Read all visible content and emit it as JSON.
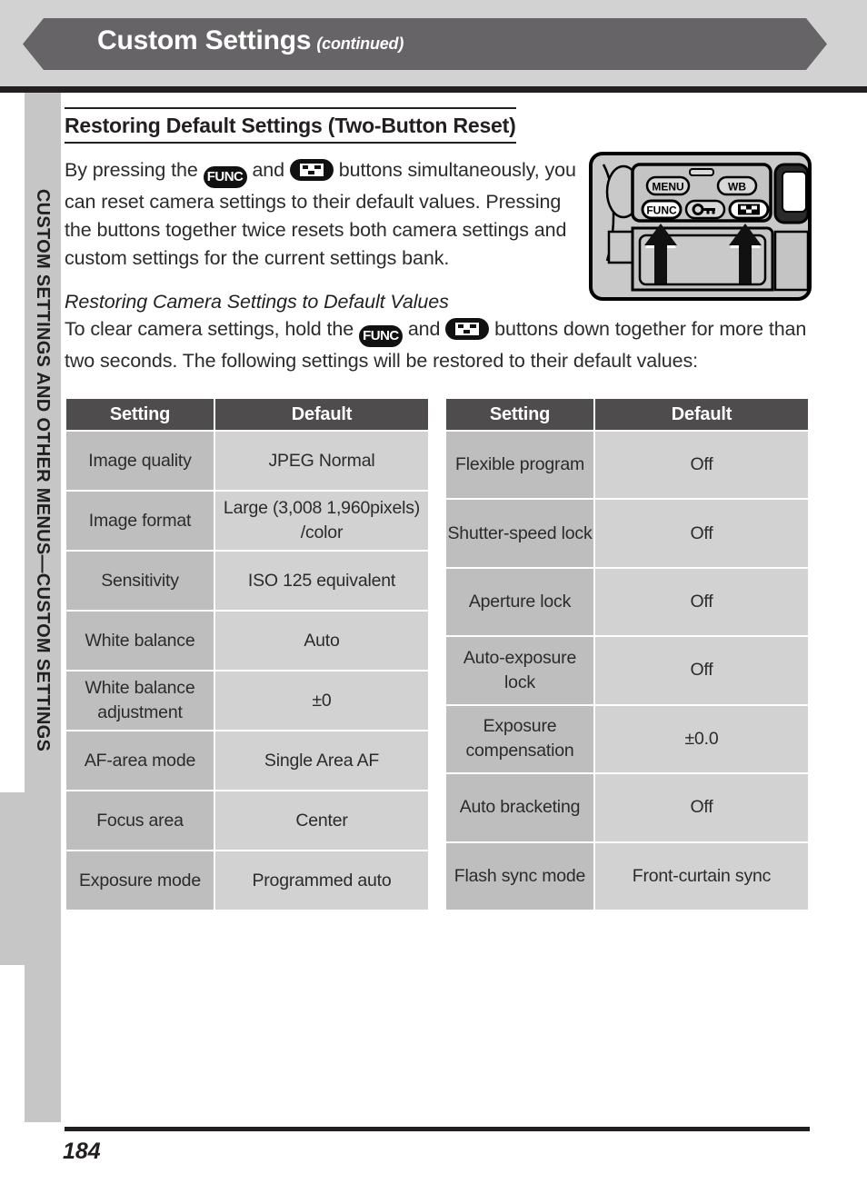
{
  "header": {
    "title": "Custom Settings",
    "continued": "(continued)",
    "band_color": "#666466"
  },
  "side_tab": {
    "label": "CUSTOM SETTINGS AND OTHER MENUS—CUSTOM SETTINGS"
  },
  "section": {
    "title": "Restoring Default Settings (Two-Button Reset)",
    "paragraph_1_a": "By pressing the",
    "paragraph_1_b": "and",
    "paragraph_1_c": "buttons simultaneously, you can reset camera settings to their default values. Pressing the buttons together twice resets both camera settings and custom settings for the current settings bank.",
    "subheading": "Restoring Camera Settings to Default Values",
    "paragraph_2_a": "To clear camera settings, hold the",
    "paragraph_2_b": "and",
    "paragraph_2_c": "buttons down together for more than two seconds. The following settings will be restored to their default values:"
  },
  "buttons": {
    "func_label": "FUNC",
    "grid_icon": "thumbnail-grid-icon"
  },
  "camera_figure": {
    "menu_label": "MENU",
    "wb_label": "WB",
    "func_label": "FUNC",
    "key_icon": "key-lock-icon",
    "grid_icon": "thumbnail-grid-icon",
    "arrow_left": "up-arrow-func",
    "arrow_right": "up-arrow-grid"
  },
  "table_left": {
    "headers": [
      "Setting",
      "Default"
    ],
    "rows": [
      {
        "setting": "Image quality",
        "default": "JPEG Normal"
      },
      {
        "setting": "Image format",
        "default": "Large (3,008   1,960pixels) /color"
      },
      {
        "setting": "Sensitivity",
        "default": "ISO 125 equivalent"
      },
      {
        "setting": "White balance",
        "default": "Auto"
      },
      {
        "setting": "White balance adjustment",
        "default": "±0"
      },
      {
        "setting": "AF-area mode",
        "default": "Single Area AF"
      },
      {
        "setting": "Focus area",
        "default": "Center"
      },
      {
        "setting": "Exposure mode",
        "default": "Programmed auto"
      }
    ]
  },
  "table_right": {
    "headers": [
      "Setting",
      "Default"
    ],
    "rows": [
      {
        "setting": "Flexible program",
        "default": "Off"
      },
      {
        "setting": "Shutter-speed lock",
        "default": "Off"
      },
      {
        "setting": "Aperture lock",
        "default": "Off"
      },
      {
        "setting": "Auto-exposure lock",
        "default": "Off"
      },
      {
        "setting": "Exposure compensation",
        "default": "±0.0"
      },
      {
        "setting": "Auto bracketing",
        "default": "Off"
      },
      {
        "setting": "Flash sync mode",
        "default": "Front-curtain sync"
      }
    ]
  },
  "footer": {
    "page_number": "184"
  }
}
